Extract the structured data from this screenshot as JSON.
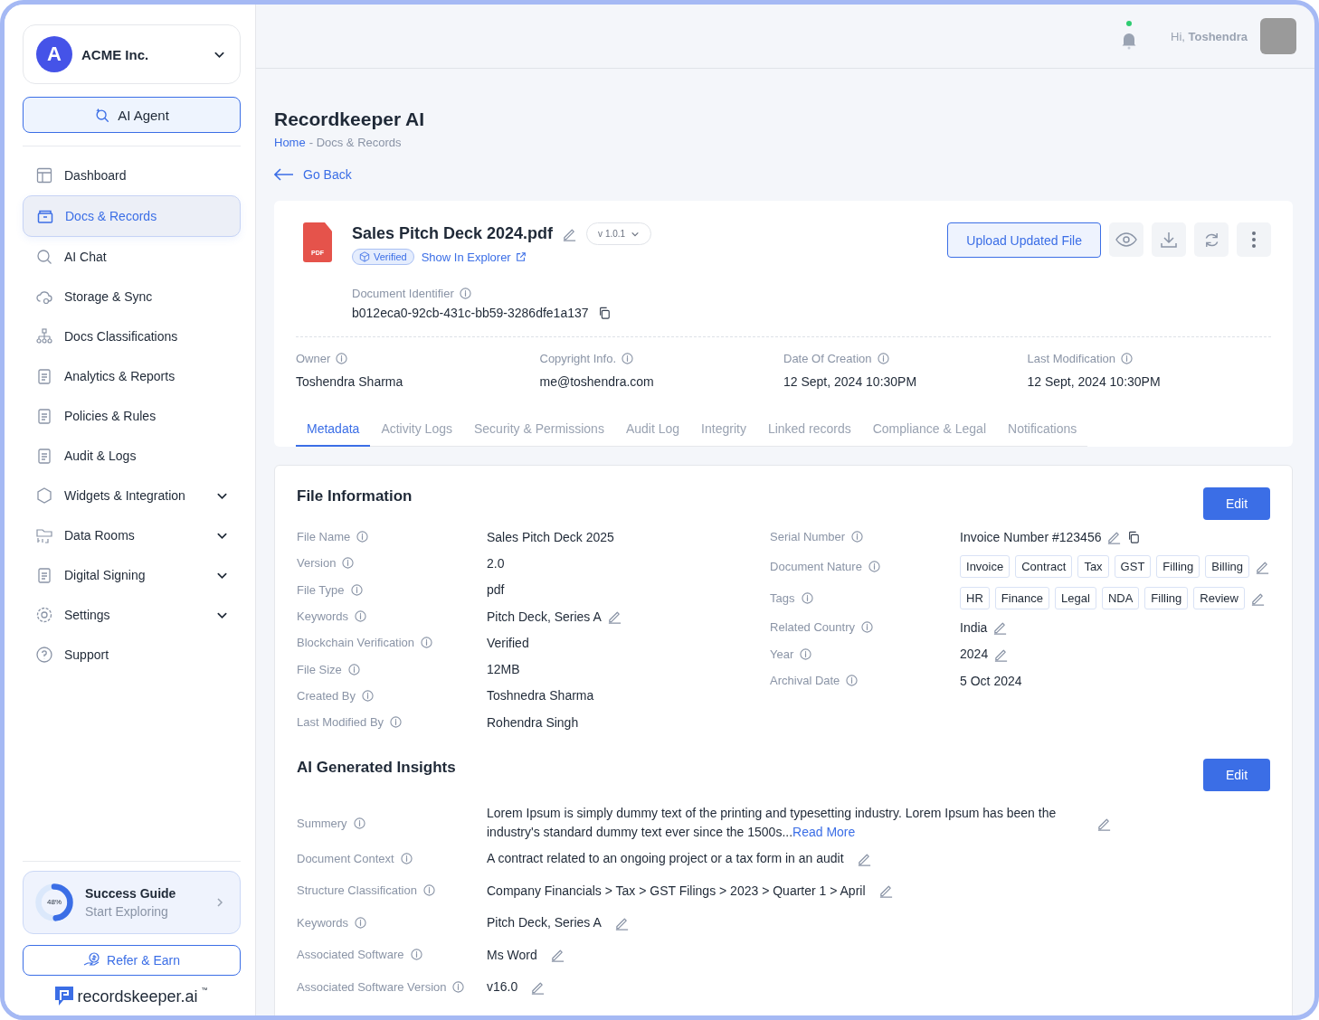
{
  "org": {
    "name": "ACME Inc.",
    "logo_letter": "A"
  },
  "ai_agent_button": "AI Agent",
  "sidebar": {
    "items": [
      {
        "label": "Dashboard",
        "selected": false,
        "has_submenu": false
      },
      {
        "label": "Docs & Records",
        "selected": true,
        "has_submenu": false
      },
      {
        "label": "AI Chat",
        "selected": false,
        "has_submenu": false
      },
      {
        "label": "Storage & Sync",
        "selected": false,
        "has_submenu": false
      },
      {
        "label": "Docs Classifications",
        "selected": false,
        "has_submenu": false
      },
      {
        "label": "Analytics & Reports",
        "selected": false,
        "has_submenu": false
      },
      {
        "label": "Policies & Rules",
        "selected": false,
        "has_submenu": false
      },
      {
        "label": "Audit & Logs",
        "selected": false,
        "has_submenu": false
      },
      {
        "label": "Widgets & Integration",
        "selected": false,
        "has_submenu": true
      },
      {
        "label": "Data Rooms",
        "selected": false,
        "has_submenu": true
      },
      {
        "label": "Digital Signing",
        "selected": false,
        "has_submenu": true
      },
      {
        "label": "Settings",
        "selected": false,
        "has_submenu": true
      },
      {
        "label": "Support",
        "selected": false,
        "has_submenu": false
      }
    ]
  },
  "success_guide": {
    "title": "Success Guide",
    "subtitle": "Start Exploring",
    "percent": "48%",
    "level": 0.48
  },
  "refer_button": "Refer & Earn",
  "brand": {
    "name": "recordskeeper.ai",
    "mark": "™"
  },
  "header": {
    "greeting": "Hi, **Toshendra**"
  },
  "page": {
    "title": "Recordkeeper AI",
    "breadcrumb": {
      "home": "Home",
      "current": "- Docs & Records"
    },
    "back": "Go Back"
  },
  "document": {
    "file_type_badge": "PDF",
    "name": "Sales Pitch Deck 2024.pdf",
    "version": "v 1.0.1",
    "verified_badge": "Verified",
    "explorer_link": "Show In Explorer",
    "identifier_label": "Document Identifier",
    "identifier": "b012eca0-92cb-431c-bb59-3286dfe1a137",
    "upload_button": "Upload Updated File"
  },
  "meta": [
    {
      "label": "Owner",
      "value": "Toshendra Sharma"
    },
    {
      "label": "Copyright Info.",
      "value": "me@toshendra.com"
    },
    {
      "label": "Date Of Creation",
      "value": "12 Sept, 2024 10:30PM"
    },
    {
      "label": "Last Modification",
      "value": "12 Sept, 2024 10:30PM"
    }
  ],
  "tabs": [
    {
      "label": "Metadata",
      "selected": true
    },
    {
      "label": "Activity Logs",
      "selected": false
    },
    {
      "label": "Security & Permissions",
      "selected": false
    },
    {
      "label": "Audit Log",
      "selected": false
    },
    {
      "label": "Integrity",
      "selected": false
    },
    {
      "label": "Linked records",
      "selected": false
    },
    {
      "label": "Compliance & Legal",
      "selected": false
    },
    {
      "label": "Notifications",
      "selected": false
    }
  ],
  "file_information": {
    "title": "File Information",
    "edit_button": "Edit",
    "left": [
      {
        "label": "File Name",
        "value": "Sales Pitch Deck 2025",
        "editable": false
      },
      {
        "label": "Version",
        "value": "2.0",
        "editable": false
      },
      {
        "label": "File Type",
        "value": "pdf",
        "editable": false
      },
      {
        "label": "Keywords",
        "value": "Pitch Deck, Series A",
        "editable": true
      },
      {
        "label": "Blockchain Verification",
        "value": "Verified",
        "editable": false
      },
      {
        "label": "File Size",
        "value": "12MB",
        "editable": false
      },
      {
        "label": "Created By",
        "value": "Toshnedra Sharma",
        "editable": false
      },
      {
        "label": "Last Modified By",
        "value": "Rohendra Singh",
        "editable": false
      }
    ],
    "right": [
      {
        "label": "Serial Number",
        "value": "Invoice Number #123456",
        "editable": true,
        "copyable": true
      },
      {
        "label": "Document Nature",
        "tags": [
          "Invoice",
          "Contract",
          "Tax",
          "GST",
          "Filling",
          "Billing"
        ],
        "editable": true
      },
      {
        "label": "Tags",
        "tags": [
          "HR",
          "Finance",
          "Legal",
          "NDA",
          "Filling",
          "Review"
        ],
        "editable": true
      },
      {
        "label": "Related Country",
        "value": "India",
        "editable": true
      },
      {
        "label": "Year",
        "value": "2024",
        "editable": true
      },
      {
        "label": "Archival Date",
        "value": "5 Oct 2024",
        "editable": false
      }
    ]
  },
  "ai_insights": {
    "title": "AI Generated Insights",
    "edit_button": "Edit",
    "rows": [
      {
        "label": "Summery",
        "value": "Lorem Ipsum is simply dummy text of the printing and typesetting industry. Lorem Ipsum has been the industry's standard dummy text ever since the 1500s...",
        "link": "Read More",
        "editable": true
      },
      {
        "label": "Document Context",
        "value": "A contract related to an ongoing project or a tax form in an audit",
        "editable": true
      },
      {
        "label": "Structure Classification",
        "value": "Company Financials > Tax > GST Filings > 2023 > Quarter 1 > April",
        "editable": true
      },
      {
        "label": "Keywords",
        "value": "Pitch Deck, Series A",
        "editable": true
      },
      {
        "label": "Associated Software",
        "value": "Ms Word",
        "editable": true
      },
      {
        "label": "Associated Software Version",
        "value": "v16.0",
        "editable": true
      }
    ]
  }
}
